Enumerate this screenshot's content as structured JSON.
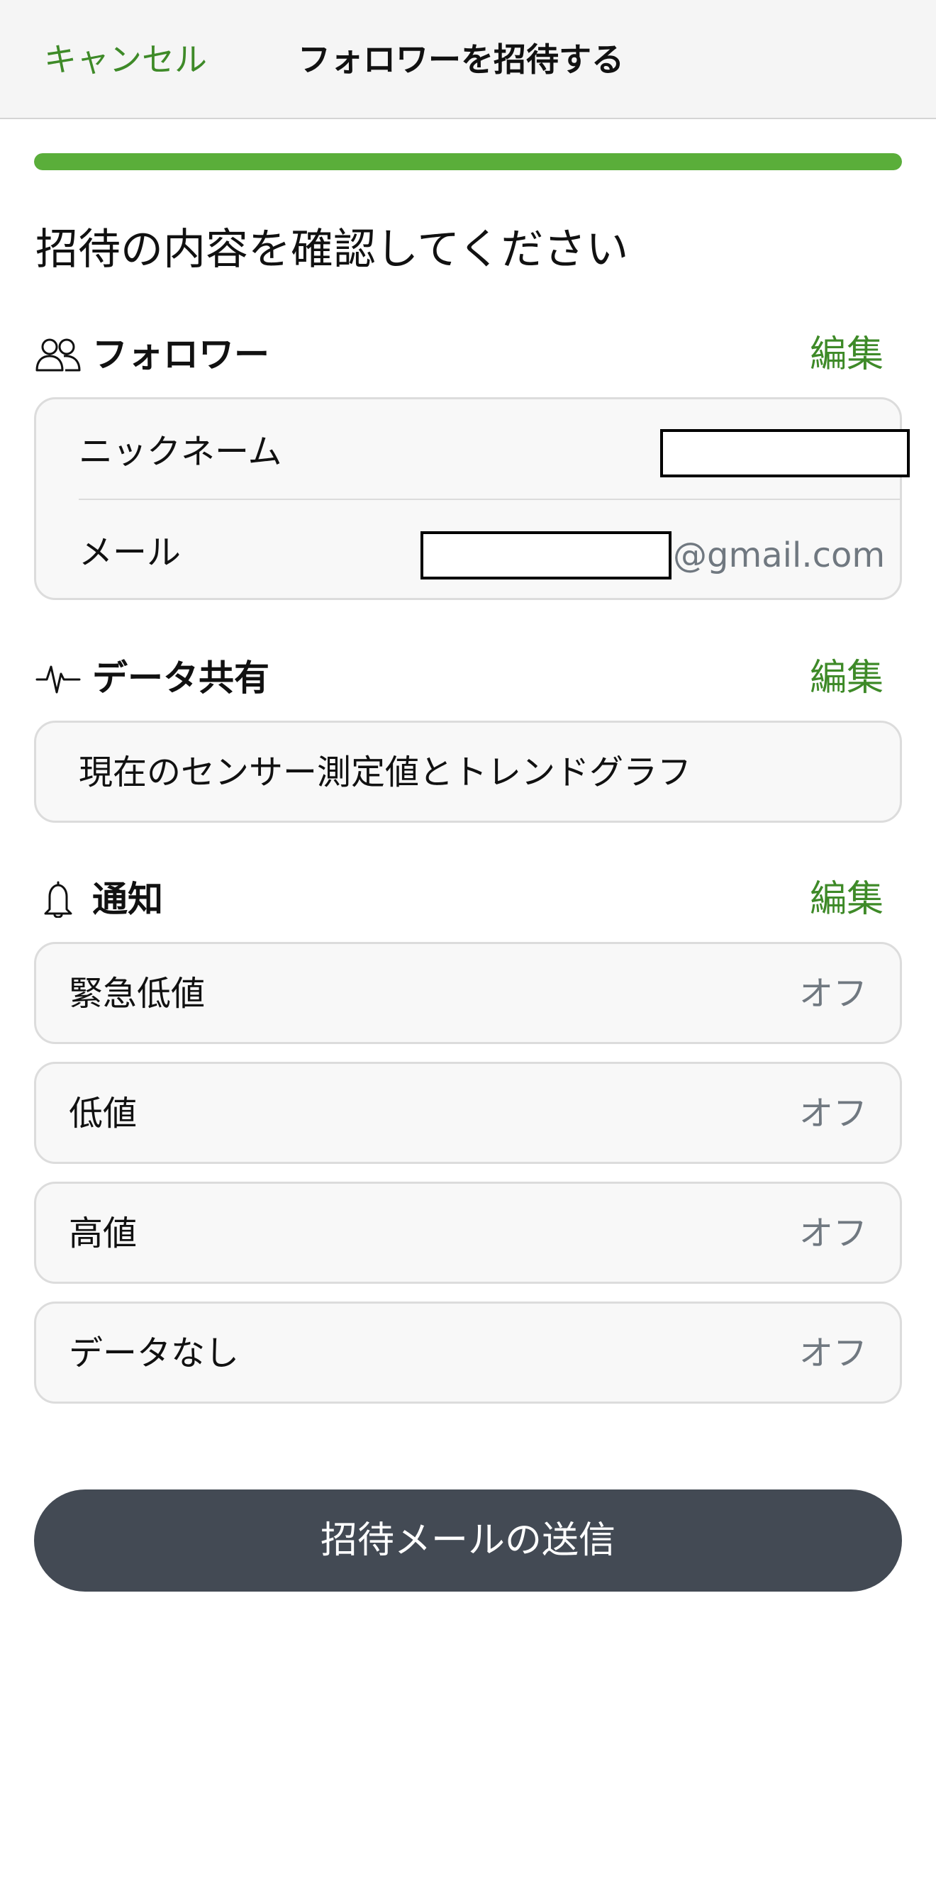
{
  "nav": {
    "cancel_label": "キャンセル",
    "title": "フォロワーを招待する"
  },
  "progress": {
    "fraction": 1.0,
    "color": "#5aae3a"
  },
  "heading": "招待の内容を確認してください",
  "follower": {
    "icon": "people-icon",
    "title": "フォロワー",
    "edit_label": "編集",
    "rows": [
      {
        "label": "ニックネーム"
      },
      {
        "label": "メール",
        "suffix": "@gmail.com"
      }
    ]
  },
  "data_sharing": {
    "icon": "pulse-icon",
    "title": "データ共有",
    "edit_label": "編集",
    "description": "現在のセンサー測定値とトレンドグラフ"
  },
  "notifications": {
    "icon": "bell-icon",
    "title": "通知",
    "edit_label": "編集",
    "items": [
      {
        "label": "緊急低値",
        "value": "オフ"
      },
      {
        "label": "低値",
        "value": "オフ"
      },
      {
        "label": "高値",
        "value": "オフ"
      },
      {
        "label": "データなし",
        "value": "オフ"
      }
    ]
  },
  "send_button_label": "招待メールの送信",
  "colors": {
    "accent": "#3e8a28",
    "button": "#434a54",
    "muted_text": "#707880"
  }
}
